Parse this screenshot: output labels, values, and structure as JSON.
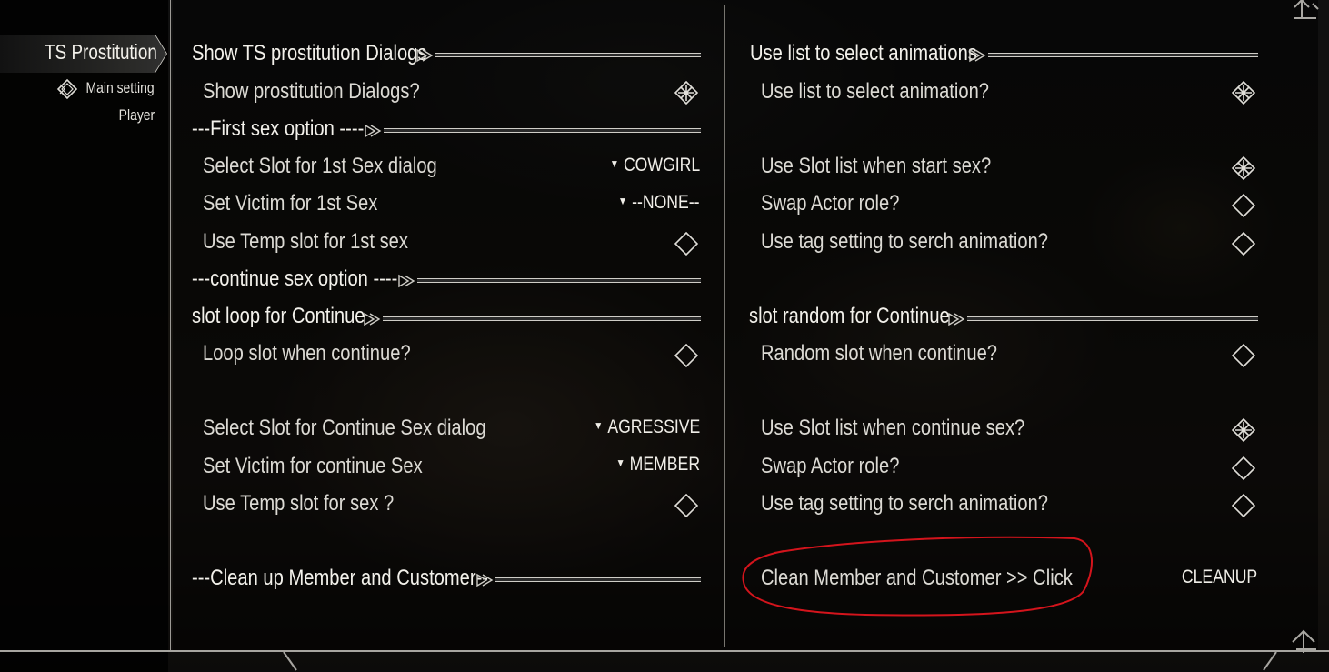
{
  "sidebar": {
    "title": "TS Prostitution",
    "items": [
      {
        "label": "Main setting",
        "icon": "mod-icon"
      },
      {
        "label": "Player"
      }
    ]
  },
  "left_column": {
    "show_dialogs": {
      "header": "Show TS prostitution Dialogs",
      "option": "Show prostitution Dialogs?",
      "checked": true
    },
    "first_sex": {
      "header": "---First sex option ----",
      "slot_label": "Select Slot for 1st Sex dialog",
      "slot_value": "COWGIRL",
      "victim_label": "Set Victim for 1st Sex",
      "victim_value": "--NONE--",
      "temp_label": "Use Temp slot for 1st sex",
      "temp_checked": false
    },
    "continue_sex": {
      "header": "---continue sex option ----"
    },
    "slot_loop": {
      "header": "slot loop for Continue",
      "loop_label": "Loop slot when continue?",
      "loop_checked": false,
      "slot_label": "Select Slot for Continue Sex dialog",
      "slot_value": "AGRESSIVE",
      "victim_label": "Set Victim for continue Sex",
      "victim_value": "MEMBER",
      "temp_label": "Use Temp slot for sex ?",
      "temp_checked": false
    },
    "cleanup": {
      "header": "---Clean up Member and Customer--"
    }
  },
  "right_column": {
    "list_select": {
      "header": "Use list to select animations",
      "use_list_label": "Use list to select animation?",
      "use_list_checked": true,
      "slot_list_label": "Use Slot list when start sex?",
      "slot_list_checked": true,
      "swap_label": "Swap Actor role?",
      "swap_checked": false,
      "tag_label": "Use tag setting to serch animation?",
      "tag_checked": false
    },
    "slot_random": {
      "header": "slot random for Continue",
      "random_label": "Random slot when continue?",
      "random_checked": false,
      "slot_list_label": "Use Slot list when continue sex?",
      "slot_list_checked": true,
      "swap_label": "Swap Actor role?",
      "swap_checked": false,
      "tag_label": "Use tag setting to serch animation?",
      "tag_checked": false
    },
    "cleanup": {
      "label": "Clean Member and Customer >> Click",
      "button": "CLEANUP"
    }
  },
  "colors": {
    "text": "#e6e4de",
    "frame": "#9c9a95",
    "annotation": "#d4141c"
  }
}
